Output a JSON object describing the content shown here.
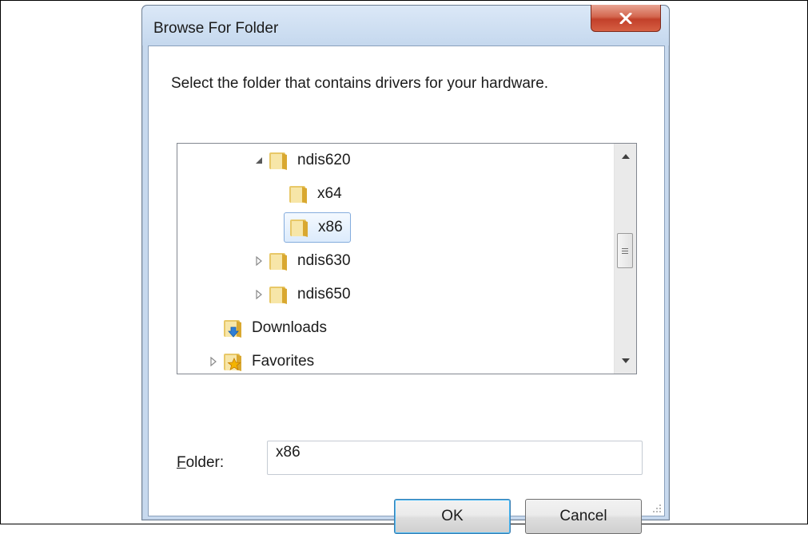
{
  "window": {
    "title": "Browse For Folder",
    "close_icon": "close-x-icon"
  },
  "instruction": "Select the folder that contains drivers for your hardware.",
  "tree": {
    "items": [
      {
        "label": "ndis620",
        "expander": "expanded",
        "icon": "folder-icon",
        "selected": false
      },
      {
        "label": "x64",
        "expander": "none",
        "icon": "folder-icon",
        "selected": false
      },
      {
        "label": "x86",
        "expander": "none",
        "icon": "folder-icon",
        "selected": true
      },
      {
        "label": "ndis630",
        "expander": "collapsed",
        "icon": "folder-icon",
        "selected": false
      },
      {
        "label": "ndis650",
        "expander": "collapsed",
        "icon": "folder-icon",
        "selected": false
      },
      {
        "label": "Downloads",
        "expander": "none",
        "icon": "downloads-folder-icon",
        "selected": false
      },
      {
        "label": "Favorites",
        "expander": "collapsed",
        "icon": "favorites-folder-icon",
        "selected": false
      }
    ]
  },
  "folder_field": {
    "label_accel": "F",
    "label_rest": "older:",
    "value": "x86"
  },
  "buttons": {
    "ok": "OK",
    "cancel": "Cancel"
  },
  "colors": {
    "title_bar": "#c5d8ee",
    "close_button": "#c2402a",
    "selection_border": "#84acdd",
    "default_button_border": "#3c7fb1"
  }
}
